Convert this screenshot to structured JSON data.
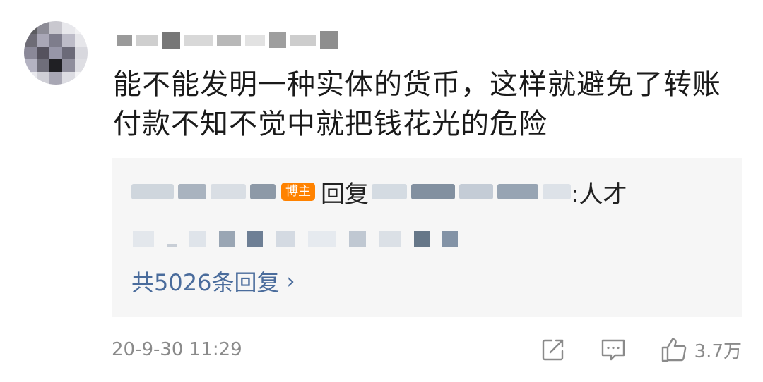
{
  "comment": {
    "text": "能不能发明一种实体的货币，这样就避免了转账付款不知不觉中就把钱花光的危险"
  },
  "reply": {
    "badge": "博主",
    "reply_word": "回复",
    "suffix": ":人才",
    "total_label": "共5026条回复"
  },
  "meta": {
    "timestamp": "20-9-30 11:29",
    "like_count": "3.7万"
  },
  "icons": {
    "share": "share-icon",
    "comment": "comment-icon",
    "like": "like-icon",
    "chevron": "chevron-right-icon"
  },
  "colors": {
    "link": "#4a6c9c",
    "badge": "#ff8200",
    "meta": "#8a8a8a",
    "reply_bg": "#f6f6f6"
  }
}
